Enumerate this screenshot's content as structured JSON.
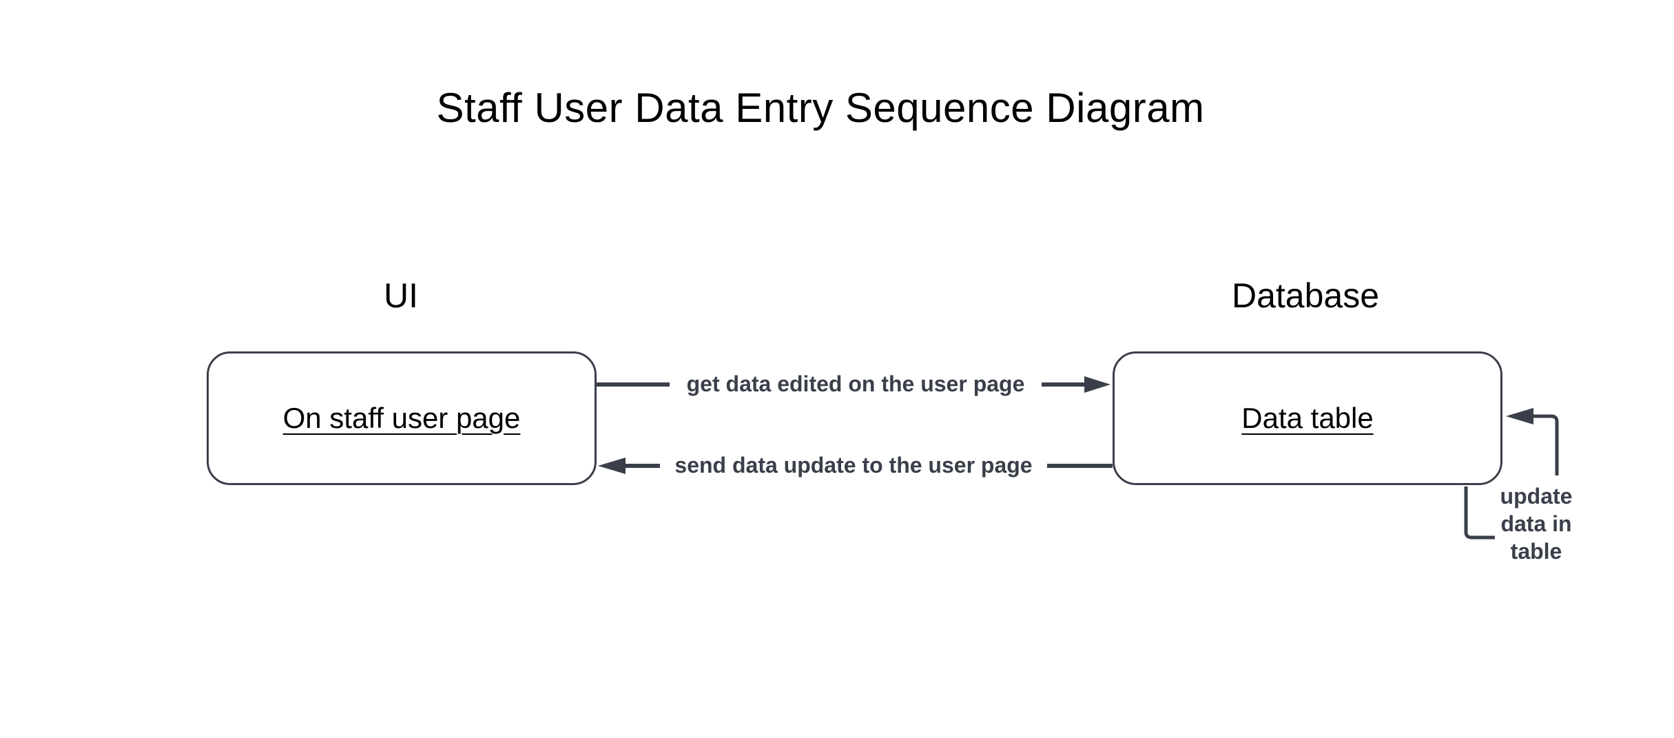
{
  "diagram": {
    "title": "Staff User Data Entry Sequence Diagram",
    "lanes": {
      "ui": "UI",
      "database": "Database"
    },
    "nodes": {
      "ui_box": "On staff user page",
      "db_box": "Data table"
    },
    "messages": {
      "get_data": "get data edited on the user page",
      "send_update": "send data update to the user page",
      "update_table": "update data in table"
    },
    "colors": {
      "stroke": "#3a3f4a",
      "text": "#000000",
      "message_text": "#3a3f4a"
    }
  }
}
